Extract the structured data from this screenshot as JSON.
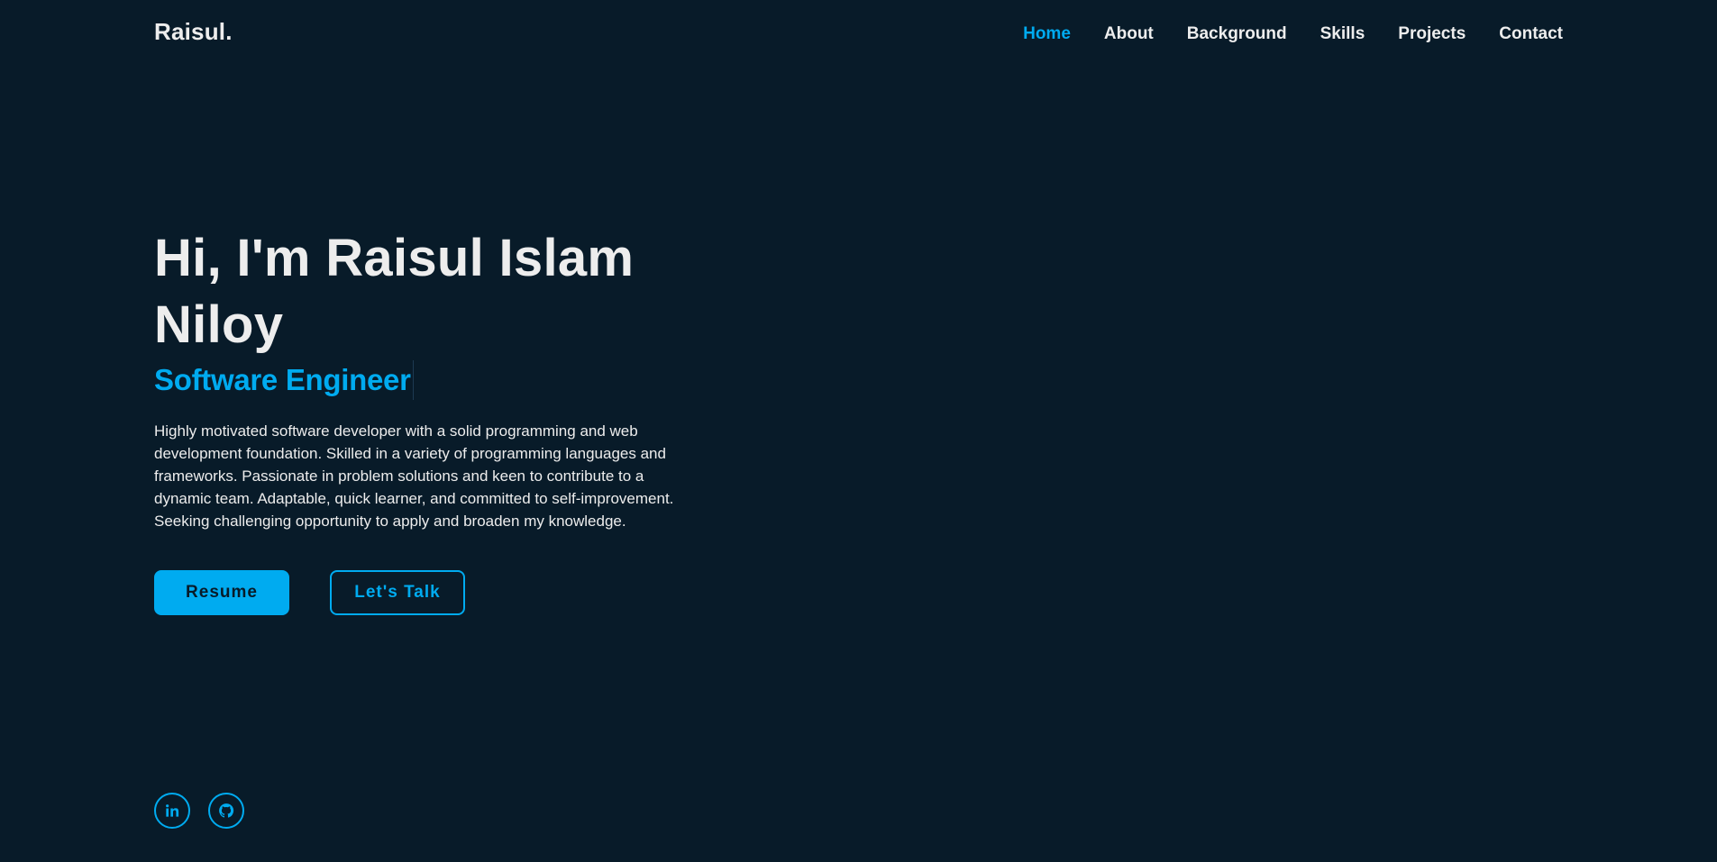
{
  "header": {
    "logo": "Raisul.",
    "nav": [
      {
        "label": "Home",
        "active": true
      },
      {
        "label": "About",
        "active": false
      },
      {
        "label": "Background",
        "active": false
      },
      {
        "label": "Skills",
        "active": false
      },
      {
        "label": "Projects",
        "active": false
      },
      {
        "label": "Contact",
        "active": false
      }
    ]
  },
  "hero": {
    "title": "Hi, I'm Raisul Islam Niloy",
    "subtitle": "Software Engineer",
    "description": "Highly motivated software developer with a solid programming and web development foundation. Skilled in a variety of programming languages and frameworks. Passionate in problem solutions and keen to contribute to a dynamic team. Adaptable, quick learner, and committed to self-improvement. Seeking challenging opportunity to apply and broaden my knowledge.",
    "buttons": {
      "primary": "Resume",
      "secondary": "Let's Talk"
    }
  },
  "social": [
    {
      "icon": "linkedin-icon"
    },
    {
      "icon": "github-icon"
    }
  ],
  "colors": {
    "background": "#081b29",
    "accent": "#00abf0",
    "text": "#ededed"
  }
}
